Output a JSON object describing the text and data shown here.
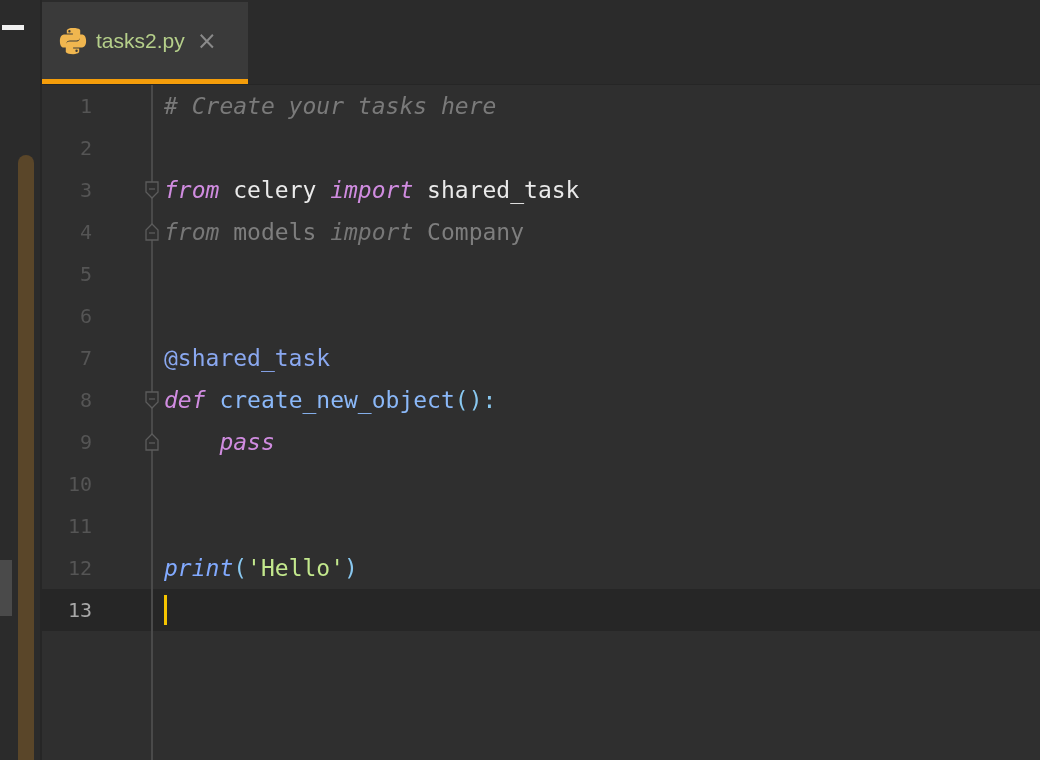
{
  "tabs": [
    {
      "label": "tasks2.py",
      "selected": true,
      "close": "×"
    }
  ],
  "lines": [
    {
      "number": "1",
      "tokens": [
        {
          "kind": "comment",
          "text": "# Create your tasks here"
        }
      ]
    },
    {
      "number": "2"
    },
    {
      "number": "3",
      "fold_start": true,
      "tokens": [
        {
          "kind": "keyword",
          "text": "from"
        },
        {
          "kind": "plain",
          "text": " celery "
        },
        {
          "kind": "keyword",
          "text": "import"
        },
        {
          "kind": "plain",
          "text": " shared_task"
        }
      ]
    },
    {
      "number": "4",
      "fold_end": true,
      "tokens": [
        {
          "kind": "unused-keyword",
          "text": "from"
        },
        {
          "kind": "unused",
          "text": " models "
        },
        {
          "kind": "unused-keyword",
          "text": "import"
        },
        {
          "kind": "unused",
          "text": " Company"
        }
      ]
    },
    {
      "number": "5"
    },
    {
      "number": "6"
    },
    {
      "number": "7",
      "tokens": [
        {
          "kind": "decorator",
          "text": "@shared_task"
        }
      ]
    },
    {
      "number": "8",
      "fold_start": true,
      "tokens": [
        {
          "kind": "keyword",
          "text": "def"
        },
        {
          "kind": "function",
          "text": " create_new_object"
        },
        {
          "kind": "paren",
          "text": "():"
        }
      ]
    },
    {
      "number": "9",
      "fold_end": true,
      "indented": true,
      "tokens": [
        {
          "kind": "keyword",
          "text": "pass"
        }
      ]
    },
    {
      "number": "10"
    },
    {
      "number": "11"
    },
    {
      "number": "12",
      "tokens": [
        {
          "kind": "builtin",
          "text": "print"
        },
        {
          "kind": "paren",
          "text": "("
        },
        {
          "kind": "string",
          "text": "'Hello'"
        },
        {
          "kind": "paren",
          "text": ")"
        }
      ]
    },
    {
      "number": "13",
      "current": true
    }
  ]
}
